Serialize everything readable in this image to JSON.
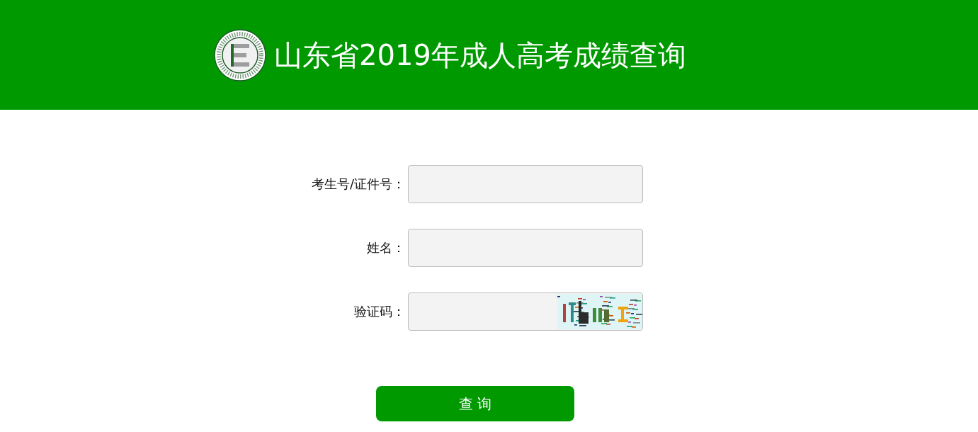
{
  "header": {
    "title": "山东省2019年成人高考成绩查询"
  },
  "form": {
    "fields": [
      {
        "label": "考生号/证件号：",
        "kind": "text"
      },
      {
        "label": "姓名：",
        "kind": "text"
      },
      {
        "label": "验证码：",
        "kind": "captcha"
      }
    ]
  },
  "submit_button": {
    "label": "查询"
  }
}
